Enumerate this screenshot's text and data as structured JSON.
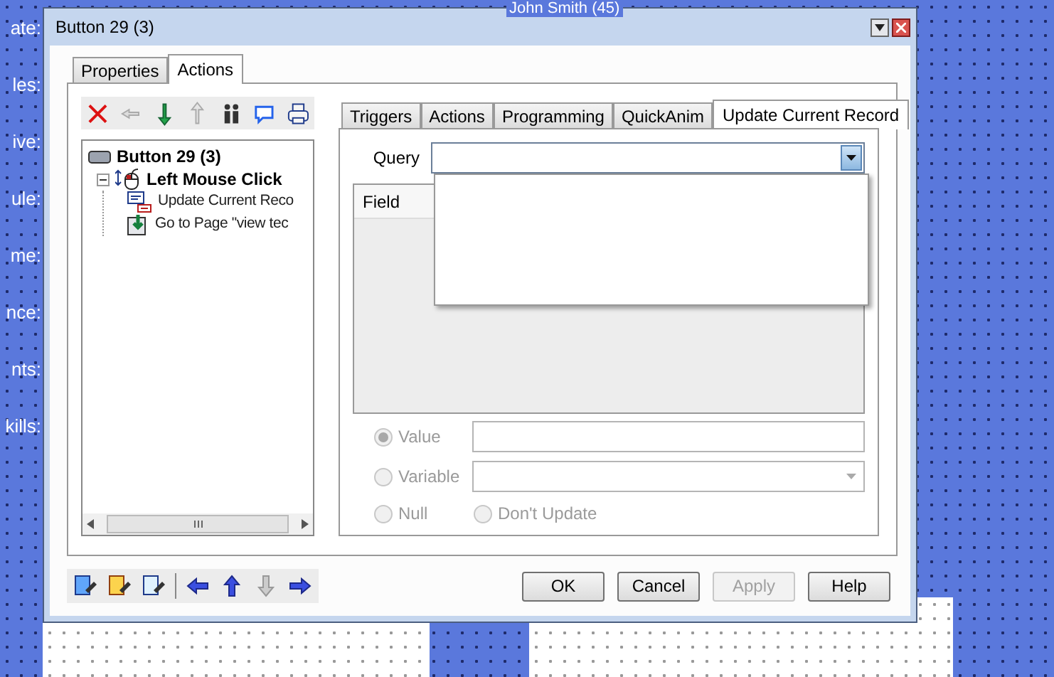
{
  "background": {
    "header": "John Smith (45)",
    "labels": [
      "ate:",
      "les:",
      "ive:",
      "ule:",
      "me:",
      "nce:",
      "nts:",
      "kills:"
    ]
  },
  "window": {
    "title": "Button 29 (3)"
  },
  "tabs": [
    {
      "label": "Properties",
      "selected": false
    },
    {
      "label": "Actions",
      "selected": true
    }
  ],
  "tree": [
    {
      "label": "Button 29 (3)",
      "kind": "button",
      "children": [
        {
          "label": "Left Mouse Click",
          "kind": "event",
          "expanded": true,
          "children": [
            {
              "label": "Update Current Reco",
              "kind": "update"
            },
            {
              "label": "Go to Page \"view tec",
              "kind": "goto"
            }
          ]
        }
      ]
    }
  ],
  "inner_tabs": [
    {
      "label": "Triggers",
      "selected": false
    },
    {
      "label": "Actions",
      "selected": false
    },
    {
      "label": "Programming",
      "selected": false
    },
    {
      "label": "QuickAnim",
      "selected": false
    },
    {
      "label": "Update Current Record",
      "selected": true
    }
  ],
  "query": {
    "label": "Query",
    "open": true
  },
  "grid": {
    "columns": [
      "Field"
    ]
  },
  "options": [
    {
      "label": "Value",
      "selected": true,
      "disabled": true,
      "kind": "text"
    },
    {
      "label": "Variable",
      "selected": false,
      "disabled": true,
      "kind": "combo"
    },
    {
      "label": "Null",
      "selected": false,
      "disabled": true,
      "kind": "plain"
    },
    {
      "label": "Don't Update",
      "selected": false,
      "disabled": true,
      "kind": "plain"
    }
  ],
  "buttons": [
    {
      "label": "OK",
      "disabled": false
    },
    {
      "label": "Cancel",
      "disabled": false
    },
    {
      "label": "Apply",
      "disabled": true
    },
    {
      "label": "Help",
      "disabled": false
    }
  ]
}
